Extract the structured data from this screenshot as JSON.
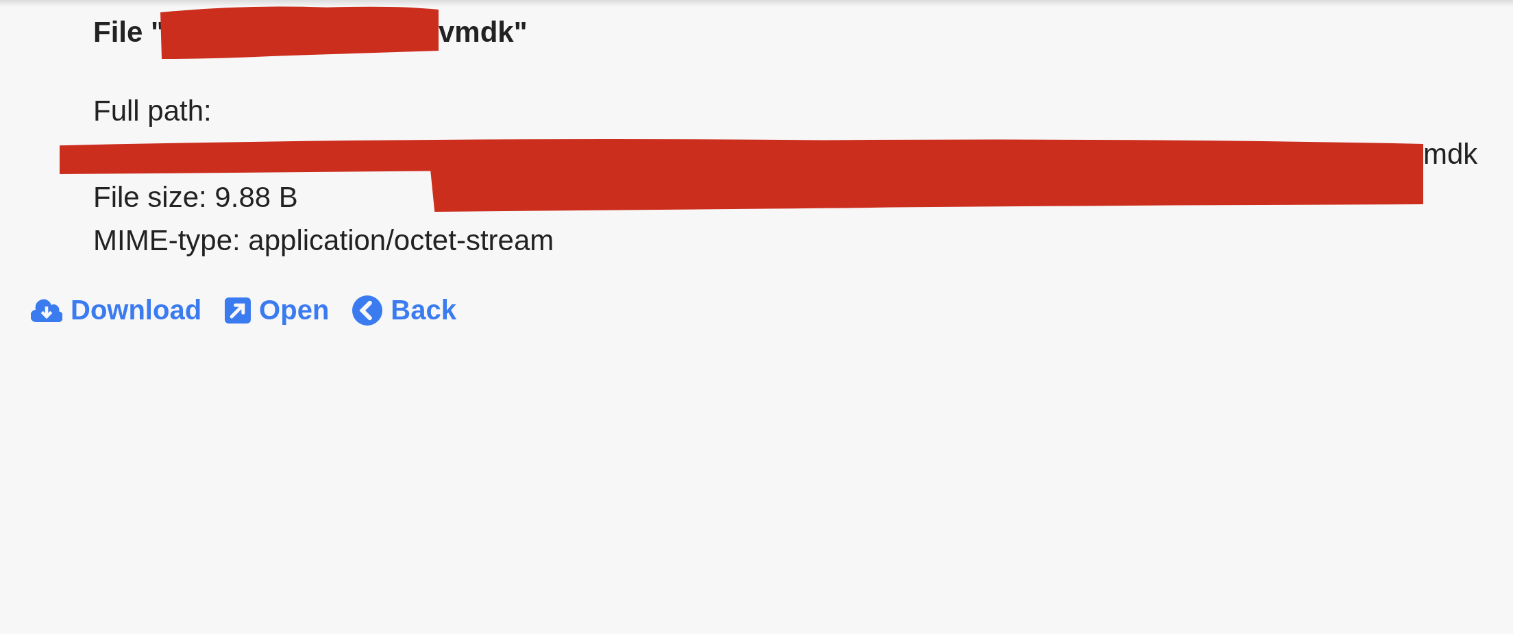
{
  "title": {
    "prefix": "File \"",
    "redacted": true,
    "suffix": "vmdk\""
  },
  "details": [
    {
      "text": "Full path:"
    },
    {
      "text": "mdk",
      "redacted": true
    },
    {
      "text": "File size: 9.88 B"
    },
    {
      "text": "MIME-type: application/octet-stream"
    }
  ],
  "actions": [
    {
      "kind": "download",
      "label": "Download"
    },
    {
      "kind": "open",
      "label": "Open"
    },
    {
      "kind": "back",
      "label": "Back"
    }
  ]
}
